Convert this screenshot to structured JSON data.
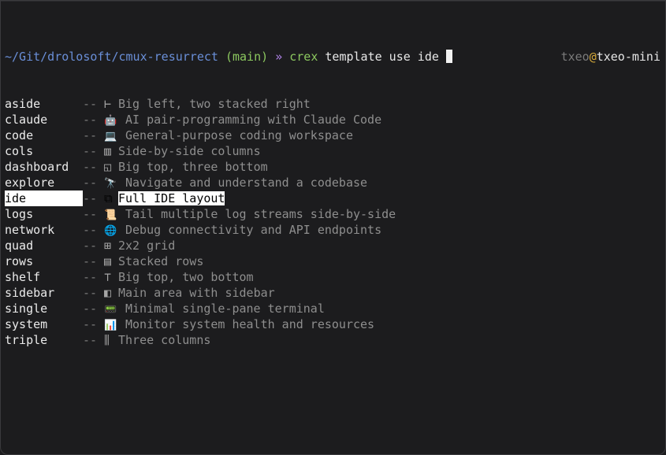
{
  "prompt": {
    "path": "~/Git/drolosoft/cmux-resurrect",
    "branch": "(main)",
    "arrow": "»",
    "command": "crex",
    "args": "template use ide",
    "user": "txeo",
    "at": "@",
    "host": "txeo-mini"
  },
  "separator": "--",
  "templates": [
    {
      "name": "aside",
      "icon": "⊢",
      "desc": "Big left, two stacked right",
      "icon_name": "aside-layout-icon"
    },
    {
      "name": "claude",
      "icon": "🤖",
      "desc": "AI pair-programming with Claude Code",
      "icon_name": "robot-icon"
    },
    {
      "name": "code",
      "icon": "💻",
      "desc": "General-purpose coding workspace",
      "icon_name": "laptop-icon"
    },
    {
      "name": "cols",
      "icon": "▥",
      "desc": "Side-by-side columns",
      "icon_name": "columns-icon"
    },
    {
      "name": "dashboard",
      "icon": "◱",
      "desc": "Big top, three bottom",
      "icon_name": "dashboard-layout-icon"
    },
    {
      "name": "explore",
      "icon": "🔭",
      "desc": "Navigate and understand a codebase",
      "icon_name": "telescope-icon"
    },
    {
      "name": "ide",
      "icon": "⧉",
      "desc": "Full IDE layout",
      "icon_name": "ide-layout-icon"
    },
    {
      "name": "logs",
      "icon": "📜",
      "desc": "Tail multiple log streams side-by-side",
      "icon_name": "scroll-icon"
    },
    {
      "name": "network",
      "icon": "🌐",
      "desc": "Debug connectivity and API endpoints",
      "icon_name": "globe-icon"
    },
    {
      "name": "quad",
      "icon": "⊞",
      "desc": "2x2 grid",
      "icon_name": "grid-icon"
    },
    {
      "name": "rows",
      "icon": "▤",
      "desc": "Stacked rows",
      "icon_name": "rows-icon"
    },
    {
      "name": "shelf",
      "icon": "⊤",
      "desc": "Big top, two bottom",
      "icon_name": "shelf-layout-icon"
    },
    {
      "name": "sidebar",
      "icon": "◧",
      "desc": "Main area with sidebar",
      "icon_name": "sidebar-layout-icon"
    },
    {
      "name": "single",
      "icon": "📟",
      "desc": "Minimal single-pane terminal",
      "icon_name": "terminal-icon"
    },
    {
      "name": "system",
      "icon": "📊",
      "desc": "Monitor system health and resources",
      "icon_name": "bar-chart-icon"
    },
    {
      "name": "triple",
      "icon": "⫼",
      "desc": "Three columns",
      "icon_name": "triple-columns-icon"
    }
  ],
  "selected_index": 6
}
